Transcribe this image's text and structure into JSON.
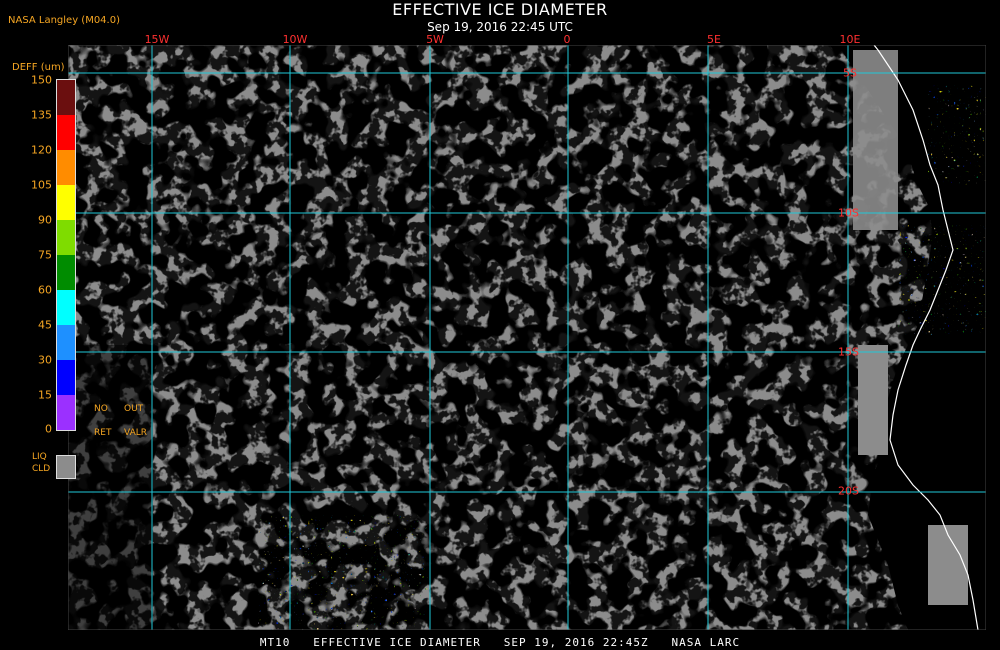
{
  "header": {
    "org": "NASA Langley (M04.0)",
    "title": "EFFECTIVE ICE DIAMETER",
    "subtitle": "Sep 19, 2016 22:45 UTC"
  },
  "legend": {
    "title": "DEFF (um)",
    "ticks": [
      "150",
      "135",
      "120",
      "105",
      "90",
      "75",
      "60",
      "45",
      "30",
      "15",
      "0"
    ],
    "colors": [
      "#6b0f0f",
      "#ff0000",
      "#ff8c00",
      "#ffff00",
      "#7fdc00",
      "#008c00",
      "#00ffff",
      "#1e90ff",
      "#0000ff",
      "#0000cd",
      "#9b30ff"
    ],
    "no_ret": [
      "NO",
      "RET"
    ],
    "out_valr": [
      "OUT",
      "VALR"
    ],
    "liq_cld": [
      "LIQ",
      "CLD"
    ]
  },
  "map": {
    "lon_labels": [
      "15W",
      "10W",
      "5W",
      "0",
      "5E",
      "10E"
    ],
    "lat_labels": [
      "5S",
      "10S",
      "15S",
      "20S"
    ],
    "colors": {
      "grid": "#20c8d8",
      "liquid_cloud": "#8c8c8c",
      "clear": "#000000",
      "coast": "#ffffff"
    }
  },
  "footer": "MT10   EFFECTIVE ICE DIAMETER   SEP 19, 2016 22:45Z   NASA LARC"
}
